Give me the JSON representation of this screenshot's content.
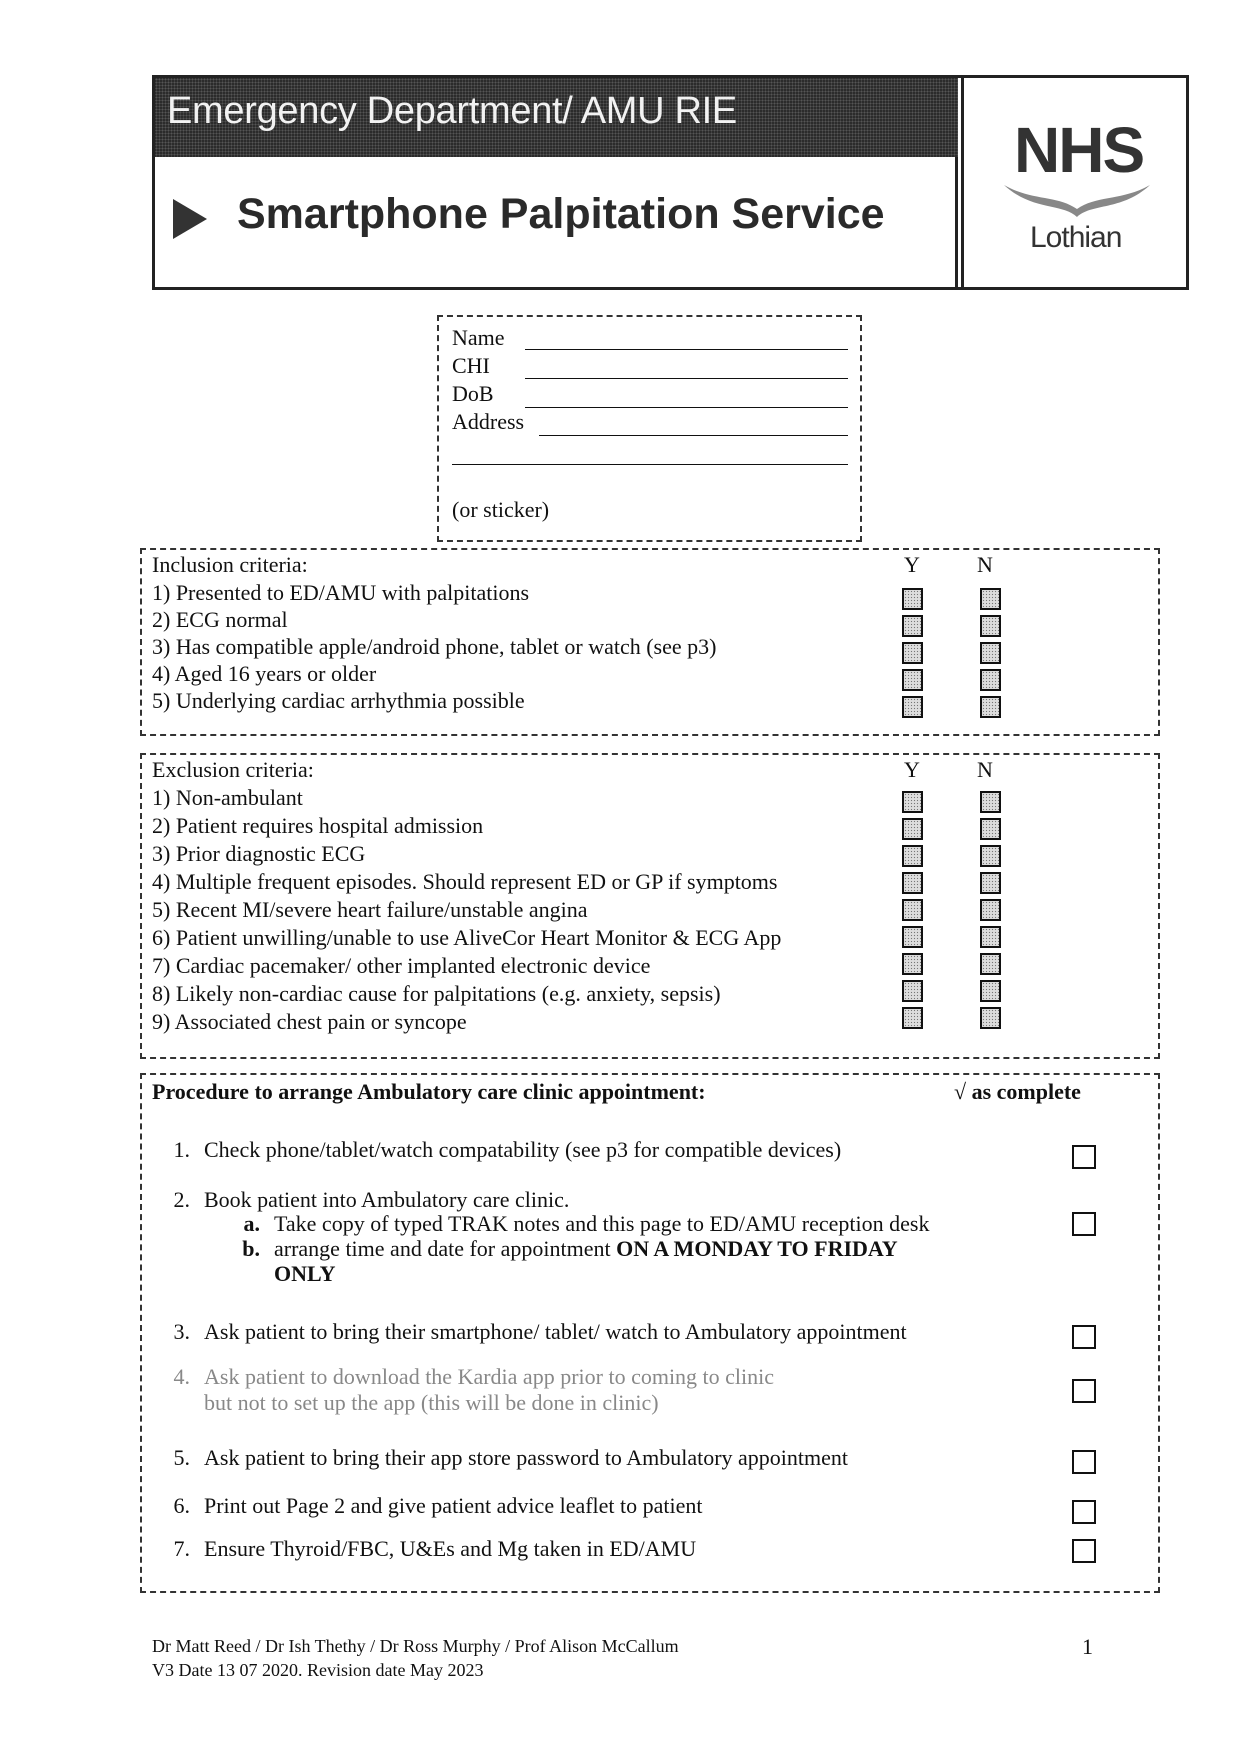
{
  "header": {
    "department": "Emergency Department/ AMU RIE",
    "title": "Smartphone Palpitation Service",
    "logo": {
      "nhs": "NHS",
      "region": "Lothian"
    }
  },
  "patient_details": {
    "fields": [
      {
        "label": "Name",
        "value": ""
      },
      {
        "label": "CHI",
        "value": ""
      },
      {
        "label": "DoB",
        "value": ""
      },
      {
        "label": "Address",
        "value": ""
      }
    ],
    "sticker_note": "(or sticker)"
  },
  "inclusion": {
    "heading": "Inclusion criteria:",
    "yes_label": "Y",
    "no_label": "N",
    "items": [
      {
        "text": "1) Presented to ED/AMU with palpitations",
        "yes": false,
        "no": false
      },
      {
        "text": "2) ECG normal",
        "yes": false,
        "no": false
      },
      {
        "text": "3) Has compatible apple/android phone, tablet or watch (see p3)",
        "yes": false,
        "no": false
      },
      {
        "text": "4) Aged 16 years or older",
        "yes": false,
        "no": false
      },
      {
        "text": "5) Underlying cardiac arrhythmia possible",
        "yes": false,
        "no": false
      }
    ]
  },
  "exclusion": {
    "heading": "Exclusion criteria:",
    "yes_label": "Y",
    "no_label": "N",
    "items": [
      {
        "text": "1) Non-ambulant",
        "yes": false,
        "no": false
      },
      {
        "text": "2) Patient requires hospital admission",
        "yes": false,
        "no": false
      },
      {
        "text": "3) Prior diagnostic ECG",
        "yes": false,
        "no": false
      },
      {
        "text": "4) Multiple frequent episodes. Should represent ED or GP if symptoms",
        "yes": false,
        "no": false
      },
      {
        "text": "5) Recent MI/severe heart failure/unstable angina",
        "yes": false,
        "no": false
      },
      {
        "text": "6) Patient unwilling/unable to use AliveCor Heart Monitor & ECG App",
        "yes": false,
        "no": false
      },
      {
        "text": "7) Cardiac pacemaker/ other implanted electronic device",
        "yes": false,
        "no": false
      },
      {
        "text": "8) Likely non-cardiac cause for palpitations (e.g. anxiety, sepsis)",
        "yes": false,
        "no": false
      },
      {
        "text": "9) Associated chest pain or syncope",
        "yes": false,
        "no": false
      }
    ]
  },
  "procedure": {
    "heading": "Procedure to arrange Ambulatory care clinic appointment:",
    "complete_label": "√ as complete",
    "steps": [
      {
        "num": "1.",
        "text": "Check phone/tablet/watch compatability (see p3 for compatible devices)",
        "checked": false
      },
      {
        "num": "2.",
        "text": "Book patient into Ambulatory care clinic."
      },
      {
        "num": "a.",
        "text": "Take copy of typed TRAK notes and this page to ED/AMU reception desk",
        "checked": false
      },
      {
        "num": "b.",
        "text": "arrange time and date for appointment ",
        "emphasis": "ON A MONDAY TO FRIDAY",
        "emphasis2": "ONLY"
      },
      {
        "num": "3.",
        "text": "Ask patient to bring their smartphone/ tablet/ watch to Ambulatory appointment",
        "checked": false
      },
      {
        "num": "4.",
        "text": "Ask patient to download the Kardia app prior to coming to clinic",
        "text2": "but not to set up the app (this will be done in clinic)",
        "checked": false
      },
      {
        "num": "5.",
        "text": "Ask patient to bring their app store password to Ambulatory appointment",
        "checked": false
      },
      {
        "num": "6.",
        "text": "Print out Page 2 and give patient advice leaflet to patient",
        "checked": false
      },
      {
        "num": "7.",
        "text": "Ensure Thyroid/FBC, U&Es and Mg taken in ED/AMU",
        "checked": false
      }
    ]
  },
  "footer": {
    "authors": "Dr Matt Reed / Dr Ish Thethy / Dr Ross Murphy / Prof Alison McCallum",
    "version": "V3 Date 13 07 2020. Revision date May 2023",
    "page_number": "1"
  }
}
